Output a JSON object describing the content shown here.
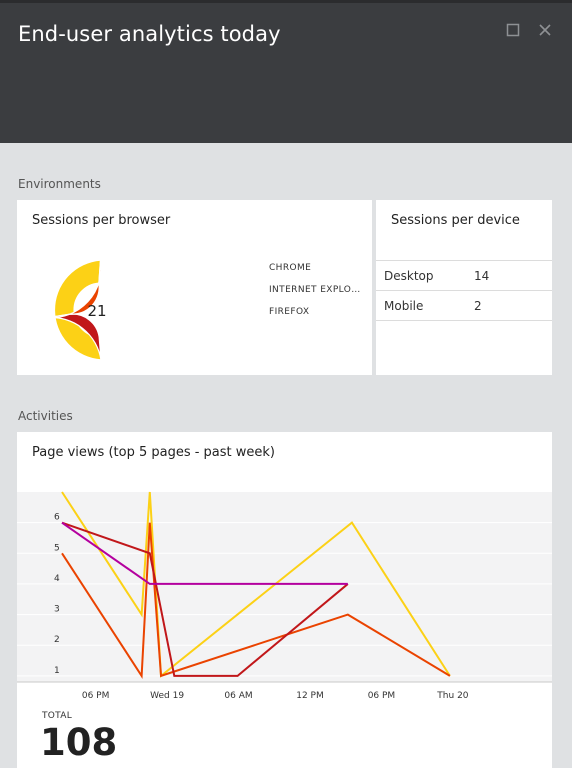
{
  "header": {
    "title": "End-user analytics today",
    "maximize_icon": "maximize-icon",
    "close_icon": "close-icon",
    "background": "#3b3d40"
  },
  "environments": {
    "label": "Environments",
    "browser_card": {
      "title": "Sessions per browser",
      "total": "21",
      "legend": [
        "CHROME",
        "INTERNET EXPLO…",
        "FIREFOX"
      ]
    },
    "device_card": {
      "title": "Sessions per device",
      "rows": [
        {
          "name": "Desktop",
          "value": "14"
        },
        {
          "name": "Mobile",
          "value": "2"
        }
      ]
    }
  },
  "activities": {
    "label": "Activities",
    "page_views_card": {
      "title": "Page views (top 5 pages - past week)",
      "total_label": "TOTAL",
      "total_value": "108"
    }
  },
  "chart_data": [
    {
      "type": "pie",
      "title": "Sessions per browser",
      "center_label": "21",
      "slices": [
        {
          "name": "CHROME",
          "value": 10,
          "color": "#fcd116"
        },
        {
          "name": "INTERNET EXPLO…",
          "value": 5,
          "color": "#c1171a"
        },
        {
          "name": "FIREFOX",
          "value": 6,
          "color": "#ea4300"
        }
      ],
      "legend_position": "right"
    },
    {
      "type": "line",
      "title": "Page views (top 5 pages - past week)",
      "yticks": [
        1,
        2,
        3,
        4,
        5,
        6
      ],
      "ylim": [
        0.8,
        7
      ],
      "xlim": [
        0,
        24
      ],
      "xticks": [
        {
          "x": 1.5,
          "label": "06 PM"
        },
        {
          "x": 5,
          "label": "Wed 19"
        },
        {
          "x": 8.5,
          "label": "06 AM"
        },
        {
          "x": 12,
          "label": "12 PM"
        },
        {
          "x": 15.5,
          "label": "06 PM"
        },
        {
          "x": 19,
          "label": "Thu 20"
        }
      ],
      "grid": true,
      "series": [
        {
          "color": "#fcd116",
          "points": [
            [
              0,
              7
            ],
            [
              3.9,
              3
            ],
            [
              4.3,
              7
            ],
            [
              4.85,
              1
            ],
            [
              14.2,
              6
            ],
            [
              19,
              1
            ]
          ]
        },
        {
          "color": "#ea4300",
          "points": [
            [
              0,
              5
            ],
            [
              3.9,
              1
            ],
            [
              4.3,
              6
            ],
            [
              4.85,
              1
            ],
            [
              14,
              3
            ],
            [
              19,
              1
            ]
          ]
        },
        {
          "color": "#c1171a",
          "points": [
            [
              0,
              6
            ],
            [
              4.3,
              5
            ],
            [
              4.6,
              4
            ],
            [
              5.5,
              1
            ],
            [
              8.6,
              1
            ],
            [
              14,
              4
            ]
          ]
        },
        {
          "color": "#b4009e",
          "points": [
            [
              0,
              6
            ],
            [
              4.3,
              4
            ],
            [
              14,
              4
            ]
          ]
        }
      ]
    }
  ]
}
